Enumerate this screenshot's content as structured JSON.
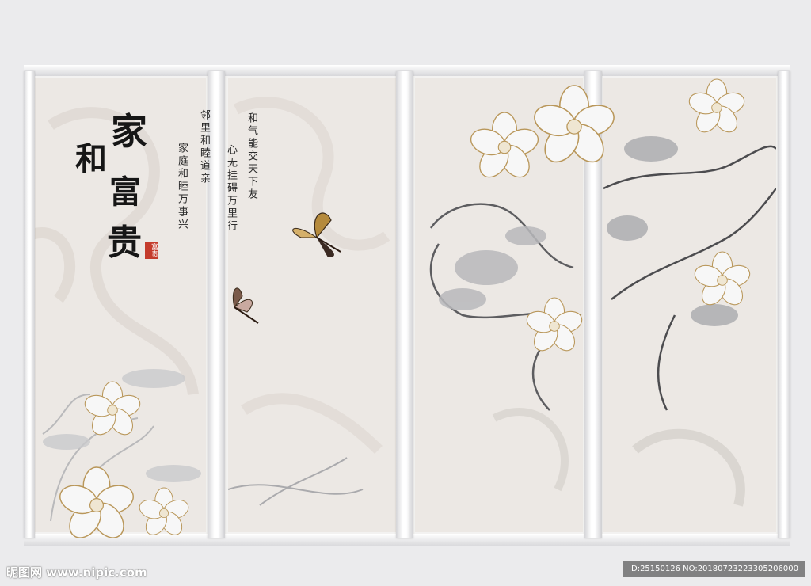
{
  "artwork": {
    "title_chars": [
      "家",
      "和",
      "富",
      "贵"
    ],
    "seal_text": "富贵",
    "poem_columns": [
      "邻里和睦道亲",
      "家庭和睦万事兴",
      "和气能交天下友",
      "心无挂碍万里行"
    ]
  },
  "watermark": {
    "site": "昵图网 www.nipic.com",
    "id_text": "ID:25150126 NO:20180723223305206000"
  }
}
